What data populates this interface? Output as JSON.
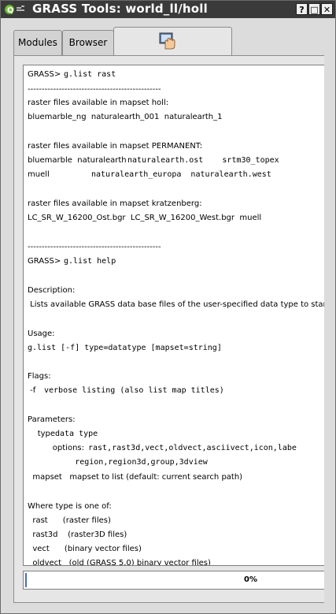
{
  "window": {
    "title": "GRASS Tools: world_ll/holl",
    "controls": {
      "help": "?",
      "maximize": "□",
      "close": "✕"
    }
  },
  "tabs": [
    {
      "label": "Modules"
    },
    {
      "label": "Browser"
    },
    {
      "label": "",
      "icon": "shell-hand-icon"
    }
  ],
  "output": {
    "lines": [
      {
        "text": "GRASS>",
        "mono": "g.list rast"
      },
      {
        "text": "-----------------------------------------------"
      },
      {
        "text": "raster files available in mapset holl:"
      },
      {
        "text": "bluemarble_ng  naturalearth_001  naturalearth_1"
      },
      {
        "text": "raster files available in mapset PERMANENT:"
      },
      {
        "text": "bluemarble  naturalearth",
        "mono": "naturalearth.ost    srtm30_topex"
      },
      {
        "text": "muell",
        "mono": "naturalearth_europa  naturalearth.west"
      },
      {
        "text": "raster files available in mapset kratzenberg:"
      },
      {
        "text": "LC_SR_W_16200_Ost.bgr  LC_SR_W_16200_West.bgr  muell"
      },
      {
        "text": "-----------------------------------------------"
      },
      {
        "text": "GRASS>",
        "mono": "g.list help"
      },
      {
        "text": "Description:"
      },
      {
        "text": " Lists available GRASS data base files of the user-specified data type to stand"
      },
      {
        "text": "Usage:"
      },
      {
        "text": "",
        "mono": "g.list [-f] type=datatype [mapset=string]"
      },
      {
        "text": "Flags:"
      },
      {
        "text": " -f",
        "mono": "verbose listing (also list map titles)"
      },
      {
        "text": "Parameters:"
      },
      {
        "text": "    type",
        "mono": "data type"
      },
      {
        "text": "          options:",
        "mono": "rast,rast3d,vect,oldvect,asciivect,icon,labe"
      },
      {
        "text": "",
        "mono": "          region,region3d,group,3dview"
      },
      {
        "text": "  mapset   mapset to list (default: current search path)"
      },
      {
        "text": "Where type is one of:"
      },
      {
        "text": "  rast      (raster files)"
      },
      {
        "text": "  rast3d    (raster3D files)"
      },
      {
        "text": "  vect      (binary vector files)"
      },
      {
        "text": "  oldvect   (old (GRASS 5.0) binary vector files)"
      }
    ]
  },
  "progress": {
    "value": 0,
    "label": "0%"
  },
  "colors": {
    "titlebar": "#3a3a3a",
    "progress_fill": "#4a6fb0"
  }
}
